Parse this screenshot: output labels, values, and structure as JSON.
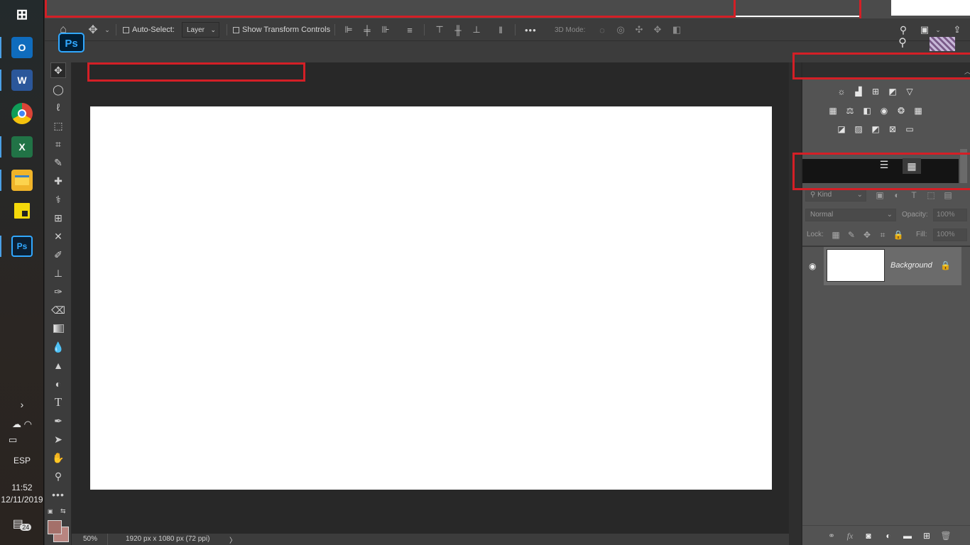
{
  "taskbar": {
    "apps": [
      {
        "name": "windows-start",
        "glyph": "⊞"
      },
      {
        "name": "outlook",
        "glyph": "O",
        "color": "#0f6cbd"
      },
      {
        "name": "word",
        "glyph": "W",
        "color": "#2b579a"
      },
      {
        "name": "chrome",
        "glyph": "●",
        "color": "#e8453c"
      },
      {
        "name": "excel",
        "glyph": "X",
        "color": "#217346"
      },
      {
        "name": "file-explorer",
        "glyph": "▬",
        "color": "#f0b429"
      },
      {
        "name": "sticky-notes",
        "glyph": "▰",
        "color": "#f5d90a"
      },
      {
        "name": "photoshop",
        "glyph": "Ps",
        "color": "#0b1f33"
      }
    ],
    "language": "ESP",
    "time": "11:52",
    "date": "12/11/2019",
    "notifications": "24"
  },
  "options_bar": {
    "auto_select_label": "Auto-Select:",
    "auto_select_value": "Layer",
    "show_transform_label": "Show Transform Controls",
    "mode_3d_label": "3D Mode:",
    "more_label": "•••"
  },
  "ps_logo": "Ps",
  "status_bar": {
    "zoom": "50%",
    "doc_info": "1920 px x 1080 px (72 ppi)",
    "arrow": "〉"
  },
  "layers_panel": {
    "filter_placeholder": "Kind",
    "blend_mode": "Normal",
    "opacity_label": "Opacity:",
    "opacity_value": "100%",
    "lock_label": "Lock:",
    "fill_label": "Fill:",
    "fill_value": "100%",
    "layers": [
      {
        "name": "Background",
        "locked": true,
        "visible": true
      }
    ]
  },
  "colors": {
    "accent_red": "#d41f26",
    "foreground_color": "#a4706a",
    "background_color": "#b88580"
  }
}
